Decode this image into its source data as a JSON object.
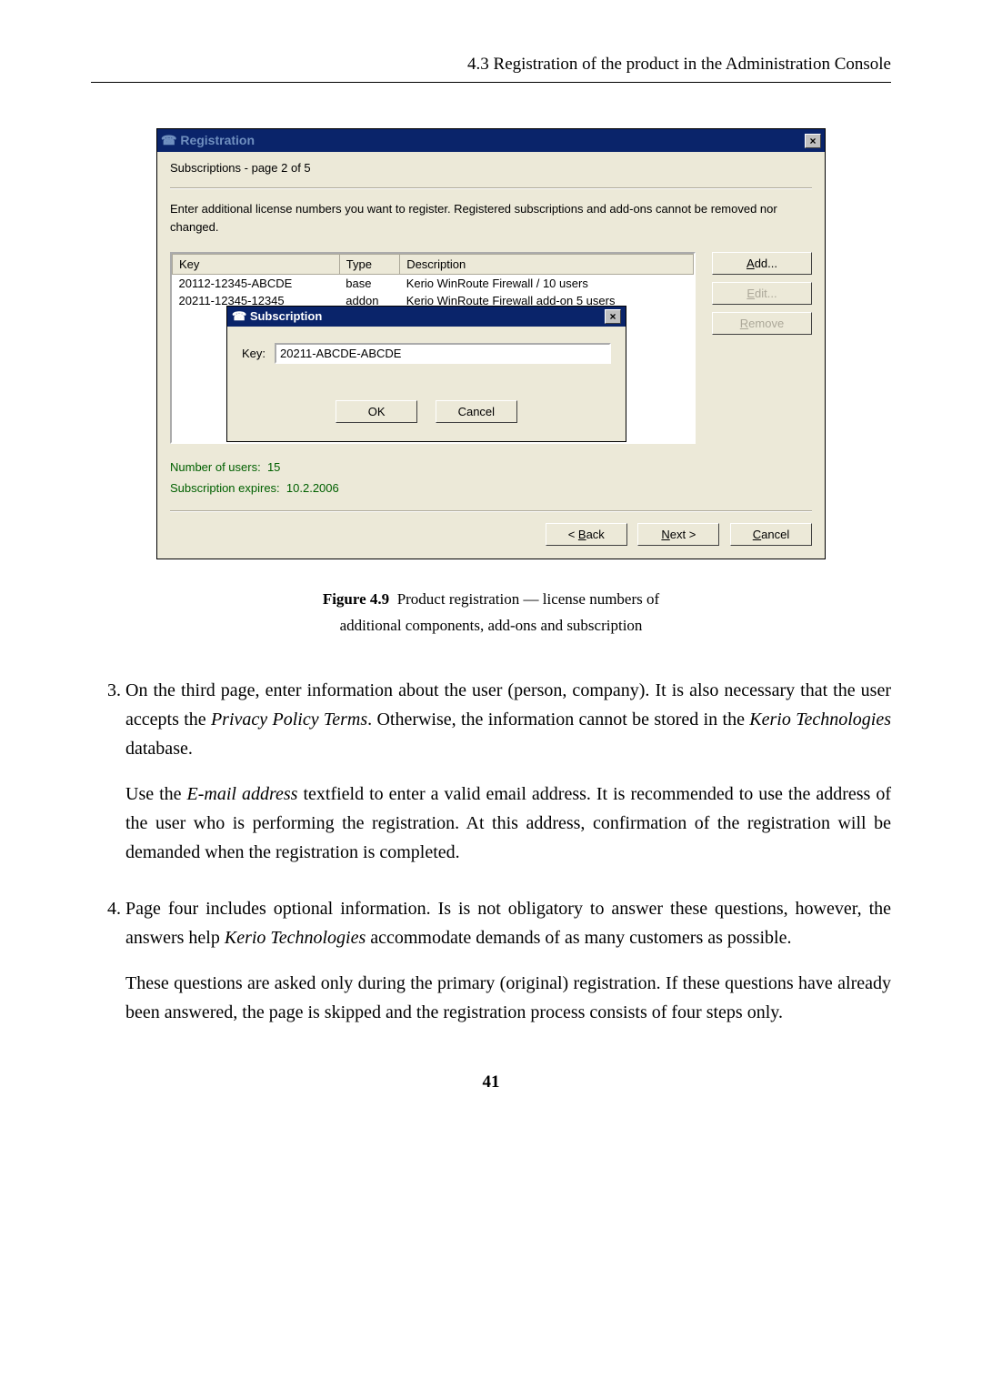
{
  "header": {
    "section_title": "4.3  Registration of the product in the Administration Console"
  },
  "dialog": {
    "title": "Registration",
    "subtitle": "Subscriptions - page 2 of 5",
    "instruction": "Enter additional license numbers you want to register. Registered subscriptions and add-ons cannot be removed nor changed.",
    "columns": {
      "key": "Key",
      "type": "Type",
      "desc": "Description"
    },
    "rows": [
      {
        "key": "20112-12345-ABCDE",
        "type": "base",
        "desc": "Kerio WinRoute Firewall / 10 users"
      },
      {
        "key": "20211-12345-12345",
        "type": "addon",
        "desc": "Kerio WinRoute Firewall add-on 5 users"
      }
    ],
    "buttons": {
      "add": "Add...",
      "edit": "Edit...",
      "remove": "Remove"
    },
    "sub": {
      "title": "Subscription",
      "key_label": "Key:",
      "key_value": "20211-ABCDE-ABCDE",
      "ok": "OK",
      "cancel": "Cancel"
    },
    "users_label": "Number of users:",
    "users_value": "15",
    "expires_label": "Subscription expires:",
    "expires_value": "10.2.2006",
    "nav": {
      "back": "< Back",
      "next": "Next >",
      "cancel": "Cancel"
    }
  },
  "caption": {
    "line1_prefix": "Figure 4.9",
    "line1_rest": "Product registration — license numbers of",
    "line2": "additional components, add-ons and subscription"
  },
  "body": {
    "item3a": "On the third page, enter information about the user (person, company). It is also necessary that the user accepts the ",
    "item3a_em": "Privacy Policy Terms",
    "item3a_tail": ". Otherwise, the information cannot be stored in the ",
    "item3a_em2": "Kerio Technologies",
    "item3a_tail2": " database.",
    "item3b_pre": "Use the ",
    "item3b_em": "E-mail address",
    "item3b_post": " textfield to enter a valid email address. It is recommended to use the address of the user who is performing the registration. At this address, confirmation of the registration will be demanded when the registration is completed.",
    "item4a_pre": "Page four includes optional information. Is is not obligatory to answer these questions, however, the answers help ",
    "item4a_em": "Kerio Technologies",
    "item4a_post": " accommodate demands of as many customers as possible.",
    "item4b": "These questions are asked only during the primary (original) registration. If these questions have already been answered, the page is skipped and the registration process consists of four steps only."
  },
  "page_number": "41"
}
